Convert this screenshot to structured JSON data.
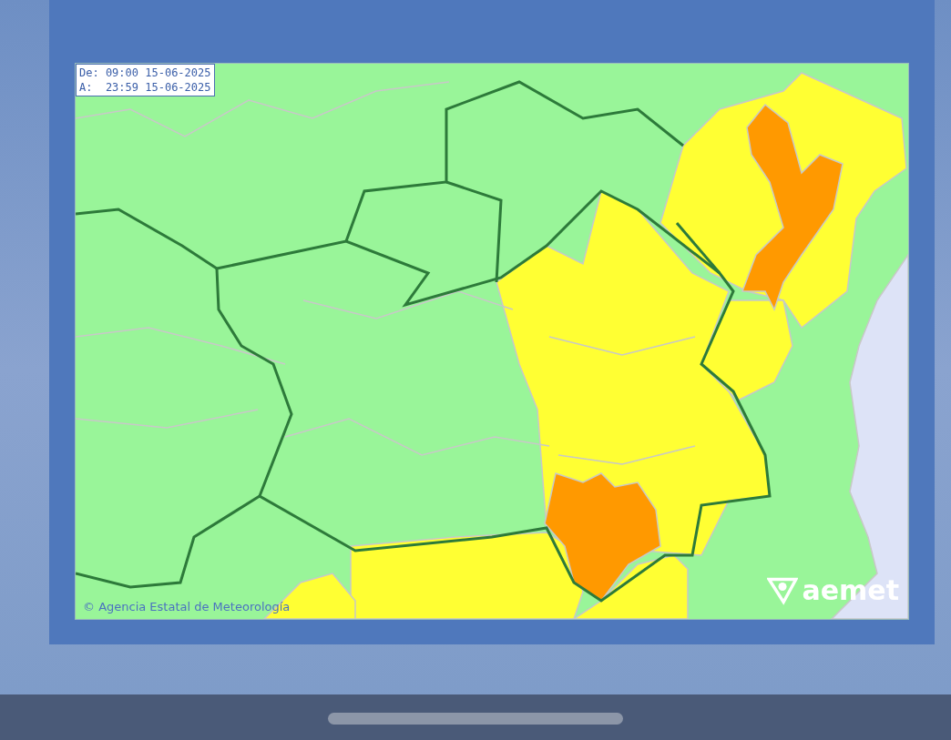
{
  "validity": {
    "from": "De: 09:00 15-06-2025",
    "to": "A:  23:59 15-06-2025"
  },
  "map": {
    "zones": [
      {
        "color": "#ffff33"
      },
      {
        "color": "#ffff33"
      },
      {
        "color": "#ffff33"
      },
      {
        "color": "#ffff33"
      },
      {
        "color": "#ffff33"
      },
      {
        "color": "#ffff33"
      },
      {
        "color": "#ff9900"
      },
      {
        "color": "#ff9900"
      },
      {
        "color": "#dde3f7"
      }
    ]
  },
  "attribution": "© Agencia Estatal de Meteorología",
  "logo": "aemet"
}
